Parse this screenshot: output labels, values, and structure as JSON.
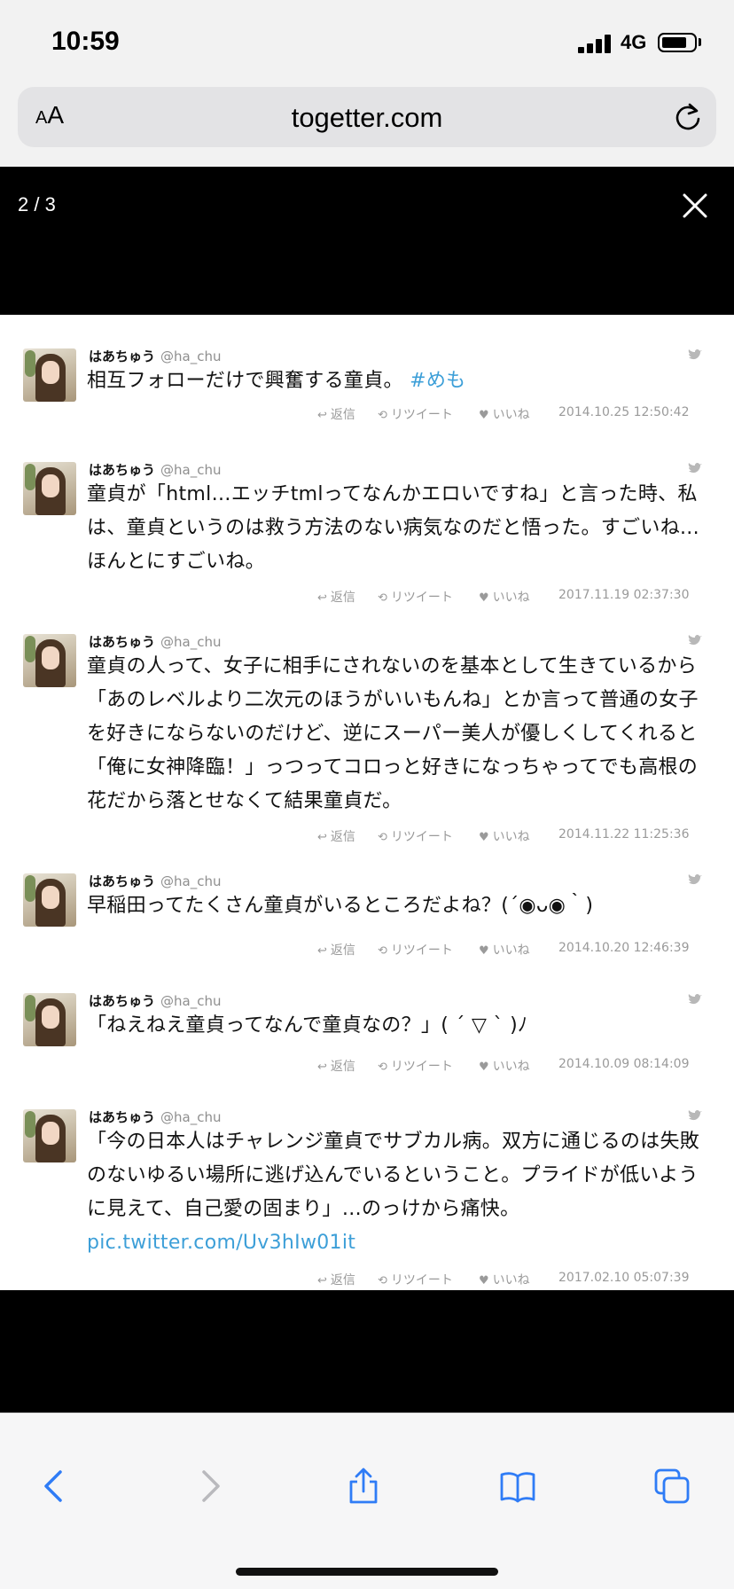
{
  "status": {
    "time": "10:59",
    "network": "4G"
  },
  "url_bar": {
    "aa_small": "A",
    "aa_large": "A",
    "url": "togetter.com"
  },
  "viewer": {
    "counter": "2 / 3"
  },
  "tweets": [
    {
      "name": "はあちゅう",
      "handle": "@ha_chu",
      "text": "相互フォローだけで興奮する童貞。",
      "link": "#めも",
      "reply": "返信",
      "retweet": "リツイート",
      "like": "いいね",
      "date": "2014.10.25 12:50:42"
    },
    {
      "name": "はあちゅう",
      "handle": "@ha_chu",
      "text": "童貞が「html…エッチtmlってなんかエロいですね」と言った時、私は、童貞というのは救う方法のない病気なのだと悟った。すごいね...ほんとにすごいね。",
      "reply": "返信",
      "retweet": "リツイート",
      "like": "いいね",
      "date": "2017.11.19 02:37:30"
    },
    {
      "name": "はあちゅう",
      "handle": "@ha_chu",
      "text": "童貞の人って、女子に相手にされないのを基本として生きているから「あのレベルより二次元のほうがいいもんね」とか言って普通の女子を好きにならないのだけど、逆にスーパー美人が優しくしてくれると「俺に女神降臨！」っつってコロっと好きになっちゃってでも高根の花だから落とせなくて結果童貞だ。",
      "reply": "返信",
      "retweet": "リツイート",
      "like": "いいね",
      "date": "2014.11.22 11:25:36"
    },
    {
      "name": "はあちゅう",
      "handle": "@ha_chu",
      "text": "早稲田ってたくさん童貞がいるところだよね？(´◉ᴗ◉｀)",
      "reply": "返信",
      "retweet": "リツイート",
      "like": "いいね",
      "date": "2014.10.20 12:46:39"
    },
    {
      "name": "はあちゅう",
      "handle": "@ha_chu",
      "text": "「ねえねえ童貞ってなんで童貞なの？」( ´ ▽ ` )ﾉ",
      "reply": "返信",
      "retweet": "リツイート",
      "like": "いいね",
      "date": "2014.10.09 08:14:09"
    },
    {
      "name": "はあちゅう",
      "handle": "@ha_chu",
      "text": "「今の日本人はチャレンジ童貞でサブカル病。双方に通じるのは失敗のないゆるい場所に逃げ込んでいるということ。プライドが低いように見えて、自己愛の固まり」…のっけから痛快。",
      "link": "pic.twitter.com/Uv3hIw01it",
      "reply": "返信",
      "retweet": "リツイート",
      "like": "いいね",
      "date": "2017.02.10 05:07:39"
    }
  ],
  "colors": {
    "link": "#3d9fd8",
    "meta": "#9a9a9a",
    "ios_blue": "#2f7cf6"
  },
  "icons": {
    "reply": "reply-icon",
    "retweet": "retweet-icon",
    "like": "heart-icon",
    "twitter": "twitter-bird-icon",
    "close": "close-icon",
    "reload": "reload-icon",
    "back": "back-icon",
    "forward": "forward-icon",
    "share": "share-icon",
    "bookmarks": "bookmarks-icon",
    "tabs": "tabs-icon"
  }
}
